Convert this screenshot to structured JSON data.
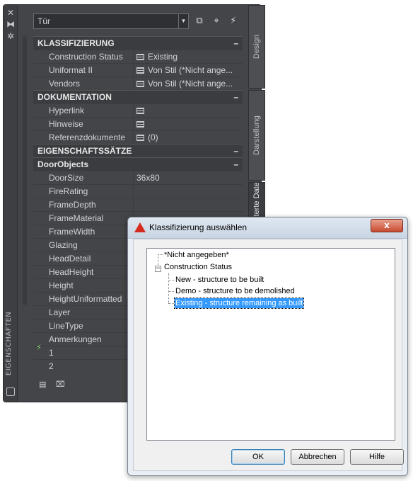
{
  "palette": {
    "title": "EIGENSCHAFTEN",
    "style_select": "Tür",
    "tabs": [
      "Design",
      "Darstellung",
      "Erweiterte Daten"
    ],
    "sections": {
      "klassifizierung": {
        "label": "KLASSIFIZIERUNG",
        "rows": [
          {
            "name": "Construction Status",
            "value": "Existing"
          },
          {
            "name": "Uniformat II",
            "value": "Von Stil (*Nicht ange..."
          },
          {
            "name": "Vendors",
            "value": "Von Stil (*Nicht ange..."
          }
        ]
      },
      "dokumentation": {
        "label": "DOKUMENTATION",
        "rows": [
          {
            "name": "Hyperlink",
            "value": ""
          },
          {
            "name": "Hinweise",
            "value": ""
          },
          {
            "name": "Referenzdokumente",
            "value": "(0)"
          }
        ]
      },
      "eigenschaftssaetze": {
        "label": "EIGENSCHAFTSSÄTZE"
      },
      "doorobjects": {
        "label": "DoorObjects",
        "rows": [
          {
            "name": "DoorSize",
            "value": "36x80"
          },
          {
            "name": "FireRating",
            "value": ""
          },
          {
            "name": "FrameDepth",
            "value": ""
          },
          {
            "name": "FrameMaterial",
            "value": ""
          },
          {
            "name": "FrameWidth",
            "value": ""
          },
          {
            "name": "Glazing",
            "value": ""
          },
          {
            "name": "HeadDetail",
            "value": ""
          },
          {
            "name": "HeadHeight",
            "value": ""
          },
          {
            "name": "Height",
            "value": ""
          },
          {
            "name": "HeightUniformatted",
            "value": ""
          },
          {
            "name": "Layer",
            "value": ""
          },
          {
            "name": "LineType",
            "value": ""
          },
          {
            "name": "Anmerkungen",
            "value": ""
          },
          {
            "name": "1",
            "value": ""
          },
          {
            "name": "2",
            "value": ""
          }
        ]
      }
    },
    "collapse_symbol": "–",
    "icons": [
      "close-icon",
      "autohide-icon",
      "settings-icon",
      "add-icon",
      "select-objects-icon",
      "quick-select-icon"
    ]
  },
  "dialog": {
    "title": "Klassifizierung auswählen",
    "close_label": "x",
    "tree": {
      "unspecified": "*Nicht angegeben*",
      "root": "Construction Status",
      "children": [
        "New - structure to be built",
        "Demo - structure to be demolished",
        "Existing - structure remaining as built"
      ],
      "selected": "Existing - structure remaining as built"
    },
    "buttons": {
      "ok": "OK",
      "cancel": "Abbrechen",
      "help": "Hilfe"
    }
  },
  "colors": {
    "palette_bg": "#434548",
    "selection": "#3399ff",
    "autodesk_red": "#d52b1e"
  }
}
